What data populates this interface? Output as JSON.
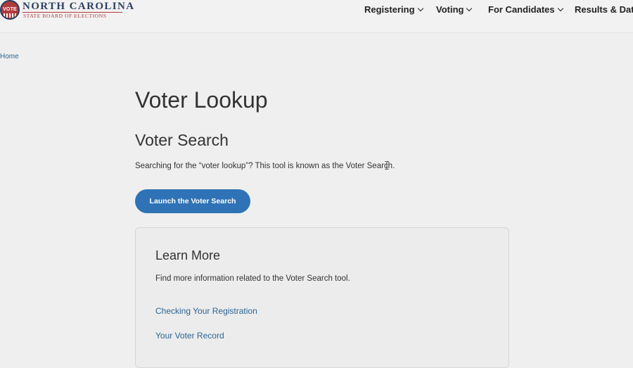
{
  "header": {
    "logo": {
      "seal_text": "VOTE",
      "org_name": "NORTH CAROLINA",
      "org_subtitle": "STATE BOARD OF ELECTIONS"
    },
    "nav": [
      {
        "label": "Registering",
        "has_dropdown": true
      },
      {
        "label": "Voting",
        "has_dropdown": true
      },
      {
        "label": "For Candidates",
        "has_dropdown": true
      },
      {
        "label": "Results & Data",
        "has_dropdown": false
      }
    ]
  },
  "breadcrumb": {
    "home": "Home"
  },
  "main": {
    "title": "Voter Lookup",
    "section_title": "Voter Search",
    "intro": "Searching for the “voter lookup”? This tool is known as the Voter Search.",
    "launch_button": "Launch the Voter Search"
  },
  "learn_more": {
    "title": "Learn More",
    "text": "Find more information related to the Voter Search tool.",
    "links": [
      {
        "label": "Checking Your Registration"
      },
      {
        "label": "Your Voter Record"
      }
    ]
  },
  "colors": {
    "accent": "#2f73b6",
    "link": "#2a6496",
    "brand_navy": "#2c3e63",
    "brand_red": "#b23a3a",
    "background": "#efefef"
  },
  "icons": {
    "seal": "vote-seal-icon",
    "dropdown": "chevron-down-icon",
    "cursor": "text-cursor-icon"
  }
}
